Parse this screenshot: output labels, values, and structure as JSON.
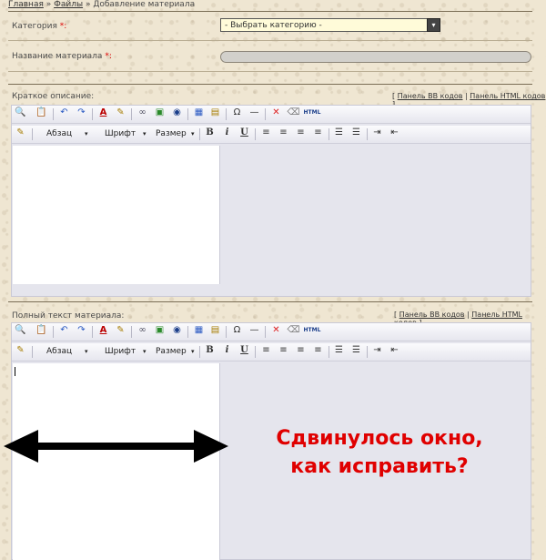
{
  "breadcrumb": {
    "home": "Главная",
    "sep1": " » ",
    "files": "Файлы",
    "sep2": " » ",
    "current": "Добавление материала"
  },
  "form": {
    "category_label": "Категория",
    "required_mark": "*:",
    "category_value": "- Выбрать категорию -",
    "title_label": "Название материала",
    "title_value": ""
  },
  "short_desc": {
    "label": "Краткое описание:",
    "links_open": "[ ",
    "bb": "Панель BB кодов",
    "pipe": " | ",
    "html": "Панель HTML кодов",
    "links_close": " ]"
  },
  "full_text": {
    "label": "Полный текст материала:",
    "links_open": "[ ",
    "bb": "Панель BB кодов",
    "pipe": " | ",
    "html": "Панель HTML кодов",
    "links_close": " ]"
  },
  "toolbar": {
    "paragraph": "Абзац",
    "font": "Шрифт",
    "size": "Размер",
    "bold": "B",
    "italic": "i",
    "underline": "U",
    "html_icon": "HTML"
  },
  "annotation": {
    "line1": "Сдвинулось окно,",
    "line2": "как исправить?"
  }
}
